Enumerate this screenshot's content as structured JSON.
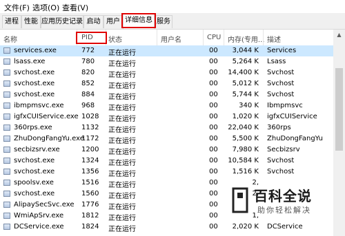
{
  "menu": [
    "文件(F)",
    "选项(O)",
    "查看(V)"
  ],
  "tabs": [
    "进程",
    "性能",
    "应用历史记录",
    "启动",
    "用户",
    "详细信息",
    "服务"
  ],
  "active_tab": "详细信息",
  "columns": [
    "名称",
    "PID",
    "状态",
    "用户名",
    "CPU",
    "内存(专用...",
    "描述"
  ],
  "rows": [
    {
      "name": "services.exe",
      "pid": "772",
      "status": "正在运行",
      "user": "",
      "cpu": "00",
      "mem": "3,044 K",
      "desc": "Services"
    },
    {
      "name": "lsass.exe",
      "pid": "780",
      "status": "正在运行",
      "user": "",
      "cpu": "00",
      "mem": "5,264 K",
      "desc": "Lsass"
    },
    {
      "name": "svchost.exe",
      "pid": "820",
      "status": "正在运行",
      "user": "",
      "cpu": "00",
      "mem": "14,400 K",
      "desc": "Svchost"
    },
    {
      "name": "svchost.exe",
      "pid": "852",
      "status": "正在运行",
      "user": "",
      "cpu": "00",
      "mem": "5,012 K",
      "desc": "Svchost"
    },
    {
      "name": "svchost.exe",
      "pid": "884",
      "status": "正在运行",
      "user": "",
      "cpu": "00",
      "mem": "5,744 K",
      "desc": "Svchost"
    },
    {
      "name": "ibmpmsvc.exe",
      "pid": "968",
      "status": "正在运行",
      "user": "",
      "cpu": "00",
      "mem": "340 K",
      "desc": "Ibmpmsvc"
    },
    {
      "name": "igfxCUIService.exe",
      "pid": "1028",
      "status": "正在运行",
      "user": "",
      "cpu": "00",
      "mem": "1,020 K",
      "desc": "igfxCUIService"
    },
    {
      "name": "360rps.exe",
      "pid": "1132",
      "status": "正在运行",
      "user": "",
      "cpu": "00",
      "mem": "22,040 K",
      "desc": "360rps"
    },
    {
      "name": "ZhuDongFangYu.exe",
      "pid": "1172",
      "status": "正在运行",
      "user": "",
      "cpu": "00",
      "mem": "5,500 K",
      "desc": "ZhuDongFangYu"
    },
    {
      "name": "secbizsrv.exe",
      "pid": "1200",
      "status": "正在运行",
      "user": "",
      "cpu": "00",
      "mem": "7,980 K",
      "desc": "Secbizsrv"
    },
    {
      "name": "svchost.exe",
      "pid": "1324",
      "status": "正在运行",
      "user": "",
      "cpu": "00",
      "mem": "10,584 K",
      "desc": "Svchost"
    },
    {
      "name": "svchost.exe",
      "pid": "1356",
      "status": "正在运行",
      "user": "",
      "cpu": "00",
      "mem": "1,516 K",
      "desc": "Svchost"
    },
    {
      "name": "spoolsv.exe",
      "pid": "1516",
      "status": "正在运行",
      "user": "",
      "cpu": "00",
      "mem": "2,",
      "desc": ""
    },
    {
      "name": "svchost.exe",
      "pid": "1560",
      "status": "正在运行",
      "user": "",
      "cpu": "00",
      "mem": "2,",
      "desc": ""
    },
    {
      "name": "AlipaySecSvc.exe",
      "pid": "1776",
      "status": "正在运行",
      "user": "",
      "cpu": "00",
      "mem": "",
      "desc": ""
    },
    {
      "name": "WmiApSrv.exe",
      "pid": "1812",
      "status": "正在运行",
      "user": "",
      "cpu": "00",
      "mem": "1,",
      "desc": ""
    },
    {
      "name": "DCService.exe",
      "pid": "1824",
      "status": "正在运行",
      "user": "",
      "cpu": "00",
      "mem": "2,020 K",
      "desc": "DCService"
    }
  ],
  "watermark": {
    "title": "百科全说",
    "subtitle": "助你轻松解决"
  },
  "colors": {
    "highlight": "#e00000",
    "selected_row": "#cce8ff"
  }
}
